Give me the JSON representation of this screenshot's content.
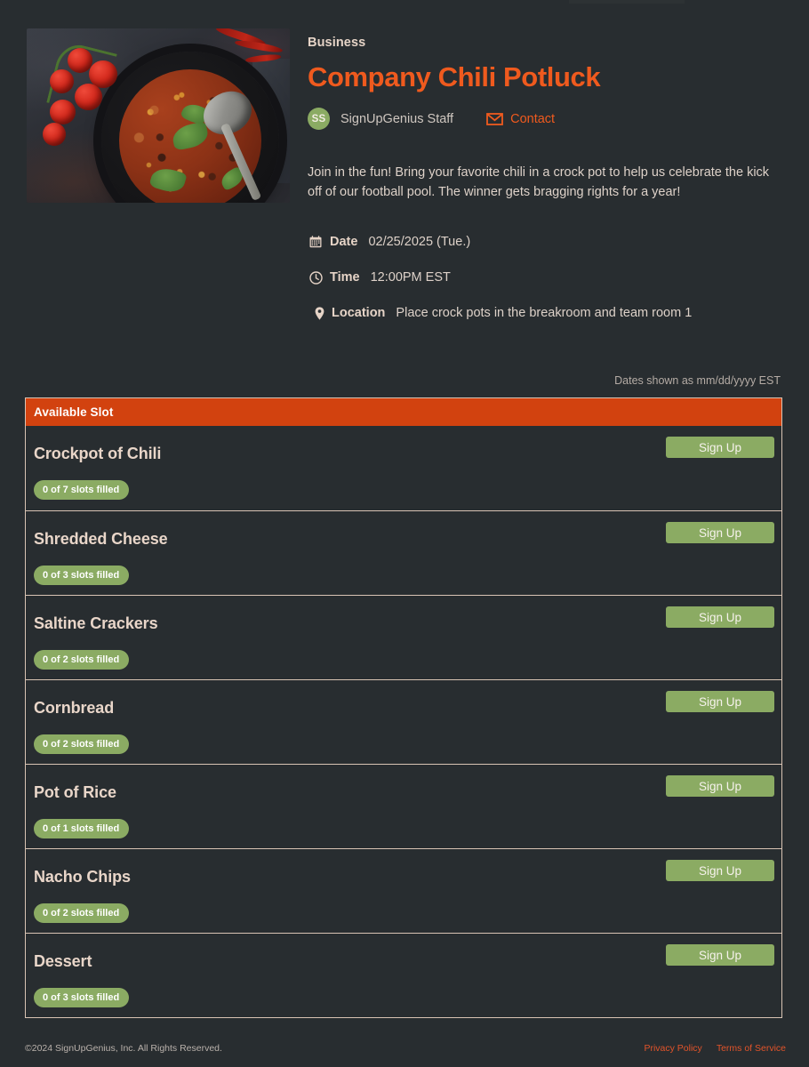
{
  "brand": {
    "accent_orange": "#ef5a1e",
    "header_bar_orange": "#d2420f",
    "green": "#8bab63",
    "background": "#282d30",
    "text_cream": "#e6d4c7",
    "border_cream": "#d9c4b4"
  },
  "header": {
    "category": "Business",
    "title": "Company Chili Potluck",
    "avatar_initials": "SS",
    "organizer": "SignUpGenius Staff",
    "contact_label": "Contact",
    "contact_icon": "envelope-icon",
    "description": "Join in the fun!  Bring your favorite chili in a crock pot to help us celebrate the kick off of our football pool.  The winner gets bragging rights for a year!",
    "hero_image_alt": "Bowl of chili with tomatoes and chili peppers"
  },
  "details": [
    {
      "icon": "calendar-icon",
      "label": "Date",
      "value": "02/25/2025 (Tue.)"
    },
    {
      "icon": "clock-icon",
      "label": "Time",
      "value": "12:00PM EST"
    },
    {
      "icon": "location-pin-icon",
      "label": "Location",
      "value": "Place crock pots in the breakroom and team room 1"
    }
  ],
  "dates_note": "Dates shown as mm/dd/yyyy EST",
  "slot_table": {
    "column_header": "Available Slot",
    "signup_label": "Sign Up",
    "rows": [
      {
        "title": "Crockpot of Chili",
        "status": "0 of 7 slots filled",
        "filled": 0,
        "total": 7
      },
      {
        "title": "Shredded Cheese",
        "status": "0 of 3 slots filled",
        "filled": 0,
        "total": 3
      },
      {
        "title": "Saltine Crackers",
        "status": "0 of 2 slots filled",
        "filled": 0,
        "total": 2
      },
      {
        "title": "Cornbread",
        "status": "0 of 2 slots filled",
        "filled": 0,
        "total": 2
      },
      {
        "title": "Pot of Rice",
        "status": "0 of 1 slots filled",
        "filled": 0,
        "total": 1
      },
      {
        "title": "Nacho Chips",
        "status": "0 of 2 slots filled",
        "filled": 0,
        "total": 2
      },
      {
        "title": "Dessert",
        "status": "0 of 3 slots filled",
        "filled": 0,
        "total": 3
      }
    ]
  },
  "footer": {
    "copyright": "©2024 SignUpGenius, Inc. All Rights Reserved.",
    "links": [
      {
        "label": "Privacy Policy"
      },
      {
        "label": "Terms of Service"
      }
    ]
  }
}
